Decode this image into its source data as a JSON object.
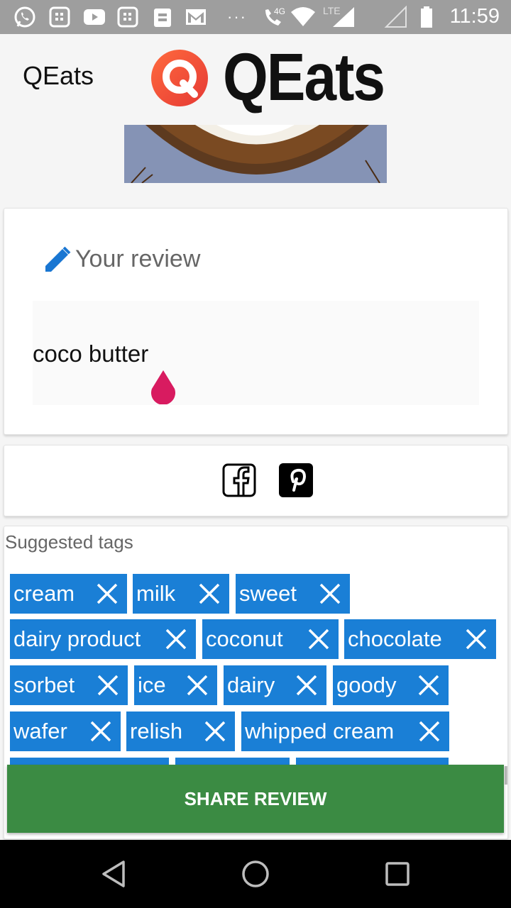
{
  "status_bar": {
    "time": "11:59",
    "network_label": "LTE",
    "signal_label": "4G",
    "icons": [
      "whatsapp-icon",
      "app-icon",
      "youtube-icon",
      "app-icon",
      "file-icon",
      "gmail-icon",
      "more-icon",
      "call-icon",
      "wifi-icon",
      "signal-icon",
      "battery-icon"
    ]
  },
  "header": {
    "app_title": "QEats",
    "logo_letter": "Q",
    "logo_text": "QEats"
  },
  "review": {
    "label": "Your review",
    "text": "coco butter"
  },
  "share": {
    "icons": [
      "facebook-icon",
      "pinterest-icon"
    ]
  },
  "tags": {
    "title": "Suggested tags",
    "items": [
      "cream",
      "milk",
      "sweet",
      "dairy product",
      "coconut",
      "chocolate",
      "sorbet",
      "ice",
      "dairy",
      "goody",
      "wafer",
      "relish",
      "whipped cream"
    ]
  },
  "share_button": {
    "label": "SHARE REVIEW"
  },
  "colors": {
    "chip": "#1a7fd6",
    "share_button": "#3b8b43",
    "cursor_handle": "#d81b60",
    "edit_icon": "#1976d2"
  }
}
